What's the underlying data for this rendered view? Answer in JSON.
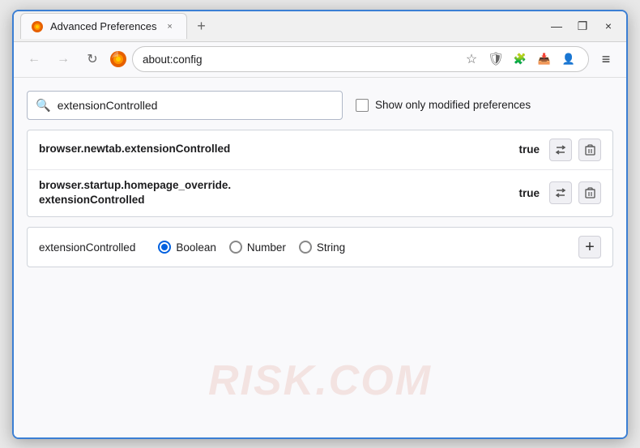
{
  "window": {
    "title": "Advanced Preferences",
    "tab_close": "×",
    "tab_new": "+",
    "win_minimize": "—",
    "win_restore": "❐",
    "win_close": "×"
  },
  "navbar": {
    "back": "←",
    "forward": "→",
    "refresh": "↻",
    "browser_name": "Firefox",
    "address": "about:config",
    "bookmark_icon": "☆",
    "shield_icon": "🛡",
    "extension_icon": "🧩",
    "pocket_icon": "📥",
    "profile_icon": "👤",
    "menu_icon": "≡"
  },
  "search": {
    "placeholder": "extensionControlled",
    "value": "extensionControlled",
    "checkbox_label": "Show only modified preferences"
  },
  "preferences": [
    {
      "name": "browser.newtab.extensionControlled",
      "value": "true"
    },
    {
      "name": "browser.startup.homepage_override.\nextensionControlled",
      "name_line1": "browser.startup.homepage_override.",
      "name_line2": "extensionControlled",
      "value": "true",
      "multiline": true
    }
  ],
  "add_preference": {
    "name": "extensionControlled",
    "types": [
      "Boolean",
      "Number",
      "String"
    ],
    "selected_type": "Boolean",
    "add_btn": "+"
  },
  "icons": {
    "search": "🔍",
    "reset": "⇄",
    "delete": "🗑",
    "add": "+"
  },
  "watermark": "RISK.COM"
}
